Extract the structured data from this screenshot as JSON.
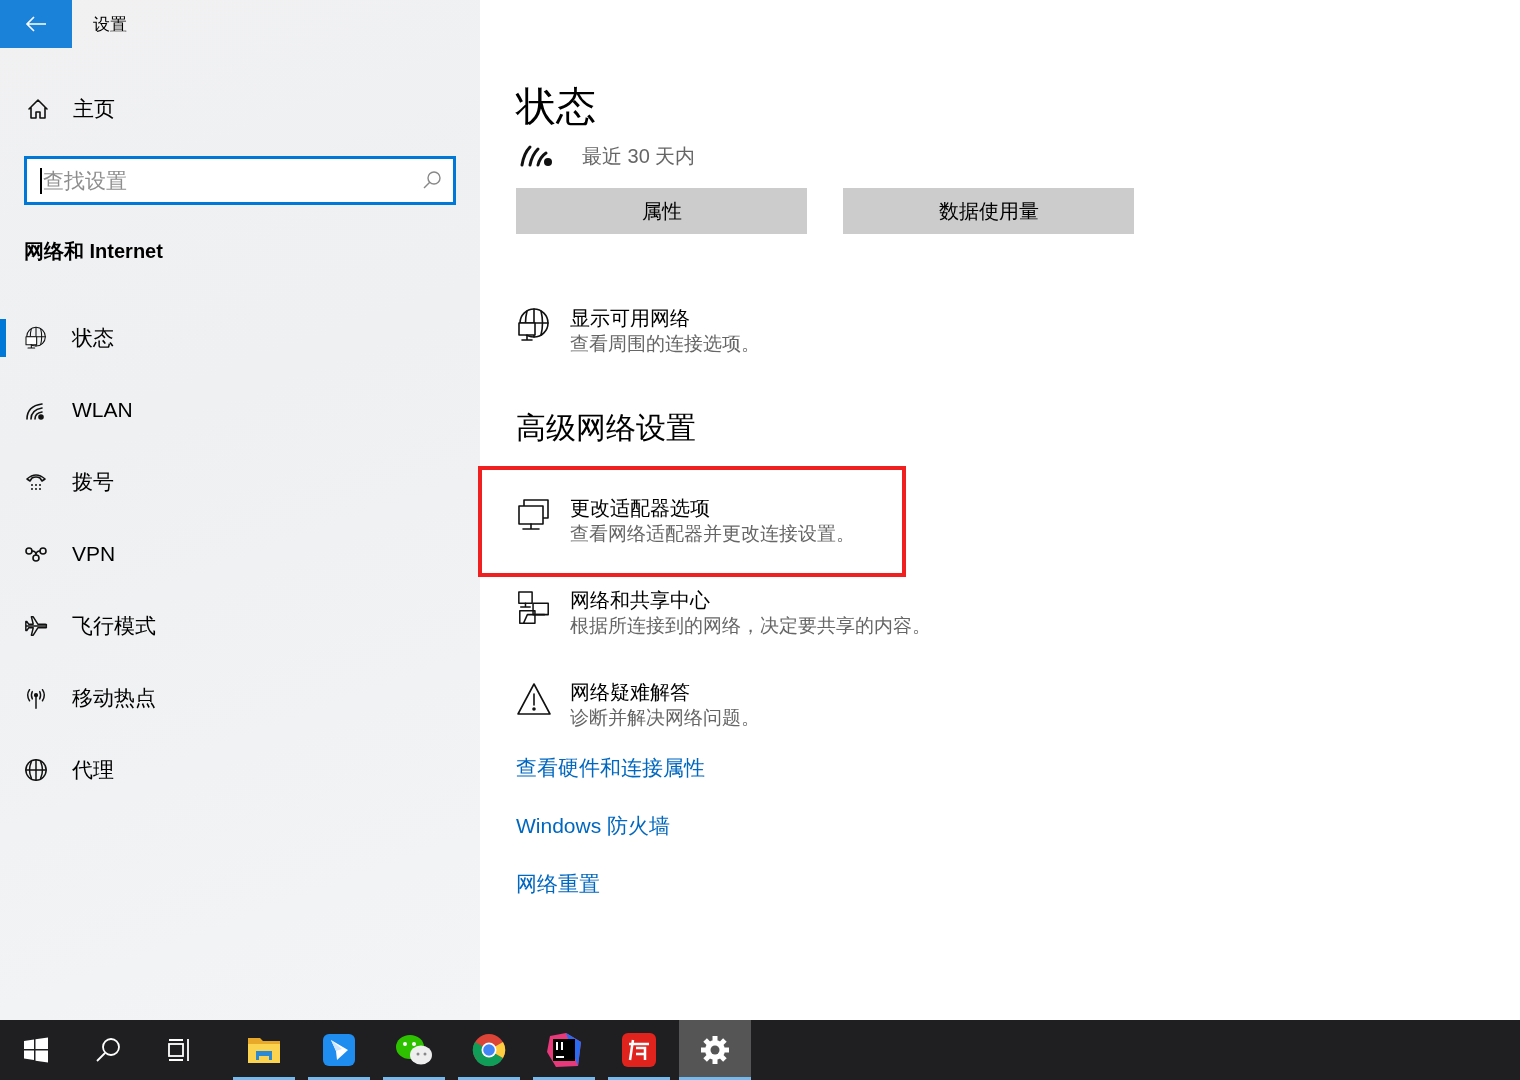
{
  "window": {
    "title": "设置"
  },
  "sidebar": {
    "home": {
      "label": "主页"
    },
    "search": {
      "placeholder": "查找设置",
      "focused": true
    },
    "section_title": "网络和 Internet",
    "items": [
      {
        "kind": "status",
        "label": "状态",
        "selected": true
      },
      {
        "kind": "wlan",
        "label": "WLAN",
        "selected": false
      },
      {
        "kind": "dialup",
        "label": "拨号",
        "selected": false
      },
      {
        "kind": "vpn",
        "label": "VPN",
        "selected": false
      },
      {
        "kind": "airplane",
        "label": "飞行模式",
        "selected": false
      },
      {
        "kind": "hotspot",
        "label": "移动热点",
        "selected": false
      },
      {
        "kind": "proxy",
        "label": "代理",
        "selected": false
      }
    ]
  },
  "main": {
    "title": "状态",
    "usage_period": "最近 30 天内",
    "buttons": [
      "属性",
      "数据使用量"
    ],
    "options": [
      {
        "kind": "status",
        "title": "显示可用网络",
        "description": "查看周围的连接选项。",
        "highlighted": false
      }
    ],
    "advanced_title": "高级网络设置",
    "advanced_options": [
      {
        "kind": "adapter",
        "title": "更改适配器选项",
        "description": "查看网络适配器并更改连接设置。",
        "highlighted": true
      },
      {
        "kind": "sharing",
        "title": "网络和共享中心",
        "description": "根据所连接到的网络，决定要共享的内容。",
        "highlighted": false
      },
      {
        "kind": "warning",
        "title": "网络疑难解答",
        "description": "诊断并解决网络问题。",
        "highlighted": false
      }
    ],
    "links": [
      "查看硬件和连接属性",
      "Windows 防火墙",
      "网络重置"
    ]
  },
  "taskbar": [
    {
      "kind": "start",
      "running": false,
      "active": false
    },
    {
      "kind": "search",
      "running": false,
      "active": false
    },
    {
      "kind": "task-view",
      "running": false,
      "active": false
    },
    {
      "kind": "folder",
      "running": true,
      "active": false
    },
    {
      "kind": "paper-plane",
      "running": true,
      "active": false
    },
    {
      "kind": "chat",
      "running": true,
      "active": false
    },
    {
      "kind": "browser",
      "running": true,
      "active": false
    },
    {
      "kind": "ide",
      "running": true,
      "active": false
    },
    {
      "kind": "dictionary",
      "running": true,
      "active": false
    },
    {
      "kind": "gear",
      "running": true,
      "active": true
    }
  ]
}
